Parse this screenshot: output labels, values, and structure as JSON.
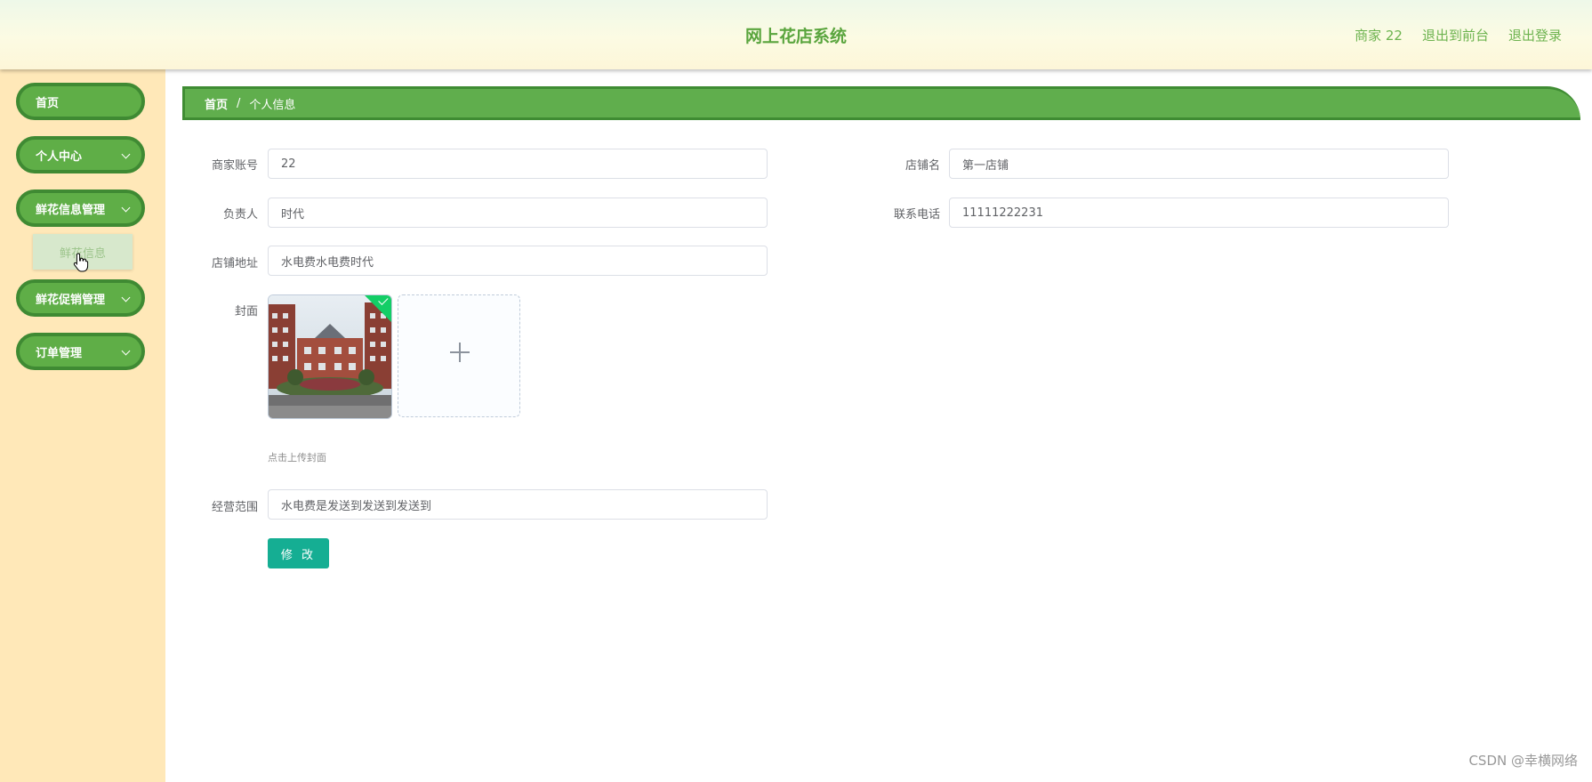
{
  "header": {
    "title": "网上花店系统",
    "user": "商家 22",
    "back_to_front": "退出到前台",
    "logout": "退出登录"
  },
  "sidebar": {
    "items": [
      {
        "label": "首页"
      },
      {
        "label": "个人中心"
      },
      {
        "label": "鲜花信息管理"
      },
      {
        "label": "鲜花促销管理"
      },
      {
        "label": "订单管理"
      }
    ],
    "submenu": {
      "label": "鲜花信息"
    }
  },
  "breadcrumb": {
    "home": "首页",
    "separator": "/",
    "current": "个人信息"
  },
  "form": {
    "account_label": "商家账号",
    "account_value": "22",
    "shop_name_label": "店铺名",
    "shop_name_value": "第一店铺",
    "owner_label": "负责人",
    "owner_value": "时代",
    "phone_label": "联系电话",
    "phone_value": "11111222231",
    "address_label": "店铺地址",
    "address_value": "水电费水电费时代",
    "cover_label": "封面",
    "cover_hint": "点击上传封面",
    "scope_label": "经营范围",
    "scope_value": "水电费是发送到发送到发送到",
    "submit_label": "修 改"
  },
  "colors": {
    "accent_green": "#5fae47",
    "button_teal": "#15ae93",
    "sidebar_bg": "#ffe8b8"
  },
  "watermark": "CSDN @幸横网络"
}
